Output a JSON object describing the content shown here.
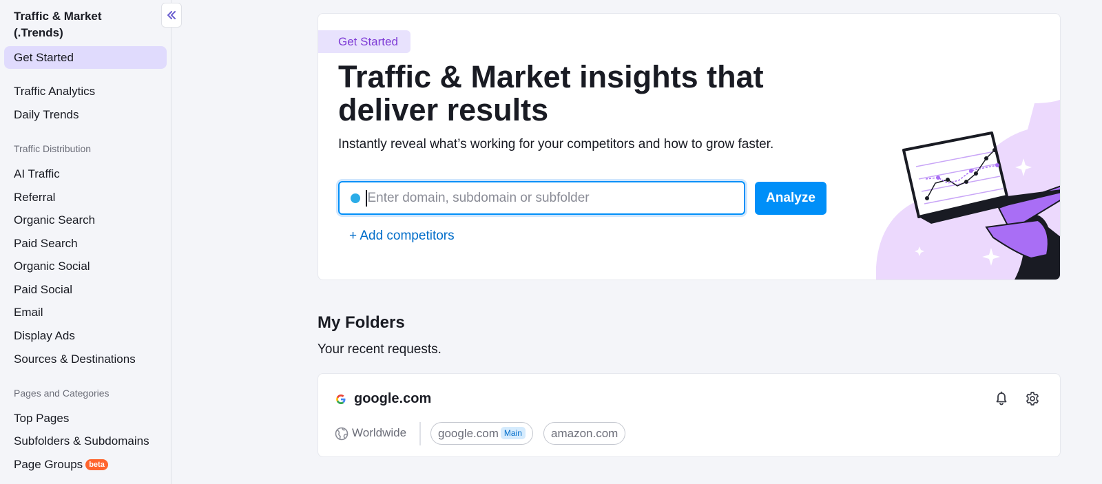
{
  "sidebar": {
    "title": "Traffic & Market (.Trends)",
    "items_top": [
      {
        "label": "Get Started",
        "active": true
      },
      {
        "label": "Traffic Analytics"
      },
      {
        "label": "Daily Trends"
      }
    ],
    "section_distribution": "Traffic Distribution",
    "items_distribution": [
      {
        "label": "AI Traffic"
      },
      {
        "label": "Referral"
      },
      {
        "label": "Organic Search"
      },
      {
        "label": "Paid Search"
      },
      {
        "label": "Organic Social"
      },
      {
        "label": "Paid Social"
      },
      {
        "label": "Email"
      },
      {
        "label": "Display Ads"
      },
      {
        "label": "Sources & Destinations"
      }
    ],
    "section_pages": "Pages and Categories",
    "items_pages": [
      {
        "label": "Top Pages"
      },
      {
        "label": "Subfolders & Subdomains"
      },
      {
        "label": "Page Groups",
        "badge": "beta"
      }
    ]
  },
  "hero": {
    "chip": "Get Started",
    "title": "Traffic & Market insights that deliver results",
    "subtitle": "Instantly reveal what’s working for your competitors and how to grow faster.",
    "search_placeholder": "Enter domain, subdomain or subfolder",
    "search_value": "",
    "analyze_label": "Analyze",
    "add_competitors_label": "+ Add competitors"
  },
  "folders": {
    "title": "My Folders",
    "subtitle": "Your recent requests.",
    "cards": [
      {
        "domain": "google.com",
        "region": "Worldwide",
        "competitors": [
          {
            "name": "google.com",
            "badge": "Main"
          },
          {
            "name": "amazon.com"
          }
        ]
      }
    ]
  },
  "colors": {
    "accent_blue": "#008ff8",
    "link_blue": "#006dca",
    "active_nav": "#e0dbfd",
    "chip_purple": "#7f3dd6",
    "beta_orange": "#ff642d"
  },
  "icons": [
    "collapse-double-chevron-left-icon",
    "google-logo-icon",
    "bell-icon",
    "gear-icon",
    "globe-icon"
  ]
}
